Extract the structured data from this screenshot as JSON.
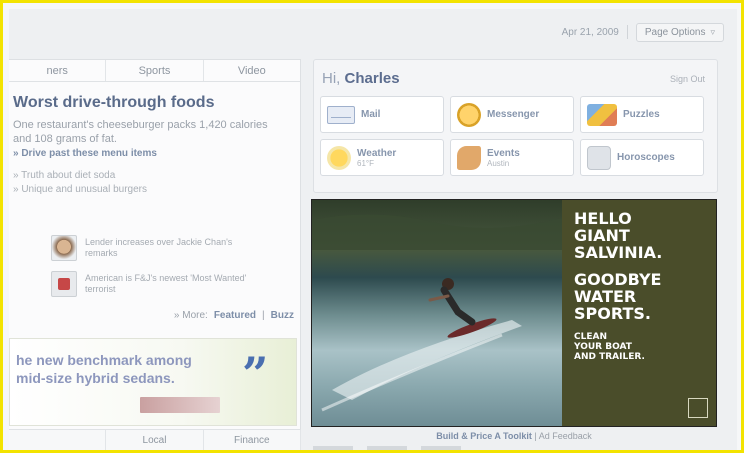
{
  "topbar": {
    "date": "Apr 21, 2009",
    "page_options": "Page Options"
  },
  "left_tabs": [
    "ners",
    "Sports",
    "Video"
  ],
  "feature": {
    "headline": "Worst drive-through foods",
    "story": "One restaurant's cheeseburger packs 1,420 calories and 108 grams of fat.",
    "link_main": "» Drive past these menu items",
    "link_1": "» Truth about diet soda",
    "link_2": "» Unique and unusual burgers"
  },
  "mini_stories": [
    {
      "thumb": "face",
      "text": "Lender increases over Jackie Chan's remarks"
    },
    {
      "thumb": "logo",
      "text": "American is F&J's newest 'Most Wanted' terrorist"
    }
  ],
  "more_row": {
    "more": "» More:",
    "featured": "Featured",
    "buzz": "Buzz"
  },
  "ad": {
    "line1": "he new benchmark among",
    "line2": "mid-size hybrid sedans.",
    "quote": "”"
  },
  "bottom_tabs": [
    "",
    "Local",
    "Finance"
  ],
  "hi_box": {
    "greeting_prefix": "Hi,",
    "name": "Charles",
    "signout": "Sign Out",
    "tiles": [
      {
        "icon": "mail-icon",
        "label": "Mail",
        "sub": ""
      },
      {
        "icon": "messenger-icon",
        "label": "Messenger",
        "sub": ""
      },
      {
        "icon": "puzzle-icon",
        "label": "Puzzles",
        "sub": ""
      },
      {
        "icon": "weather-icon",
        "label": "Weather",
        "sub": "61°F"
      },
      {
        "icon": "events-icon",
        "label": "Events",
        "sub": "Austin"
      },
      {
        "icon": "horoscopes-icon",
        "label": "Horoscopes",
        "sub": ""
      }
    ]
  },
  "promo": {
    "line1": "HELLO",
    "line2": "GIANT",
    "line3": "SALVINIA.",
    "line4": "GOODBYE",
    "line5": "WATER",
    "line6": "SPORTS.",
    "small1": "CLEAN",
    "small2": "YOUR BOAT",
    "small3": "AND TRAILER."
  },
  "promo_links": {
    "bold": "Build & Price A Toolkit",
    "rest": "Ad Feedback"
  },
  "colors": {
    "frame": "#f3e300",
    "promo_panel": "#4a4d2a",
    "link": "#7d8ea8"
  }
}
